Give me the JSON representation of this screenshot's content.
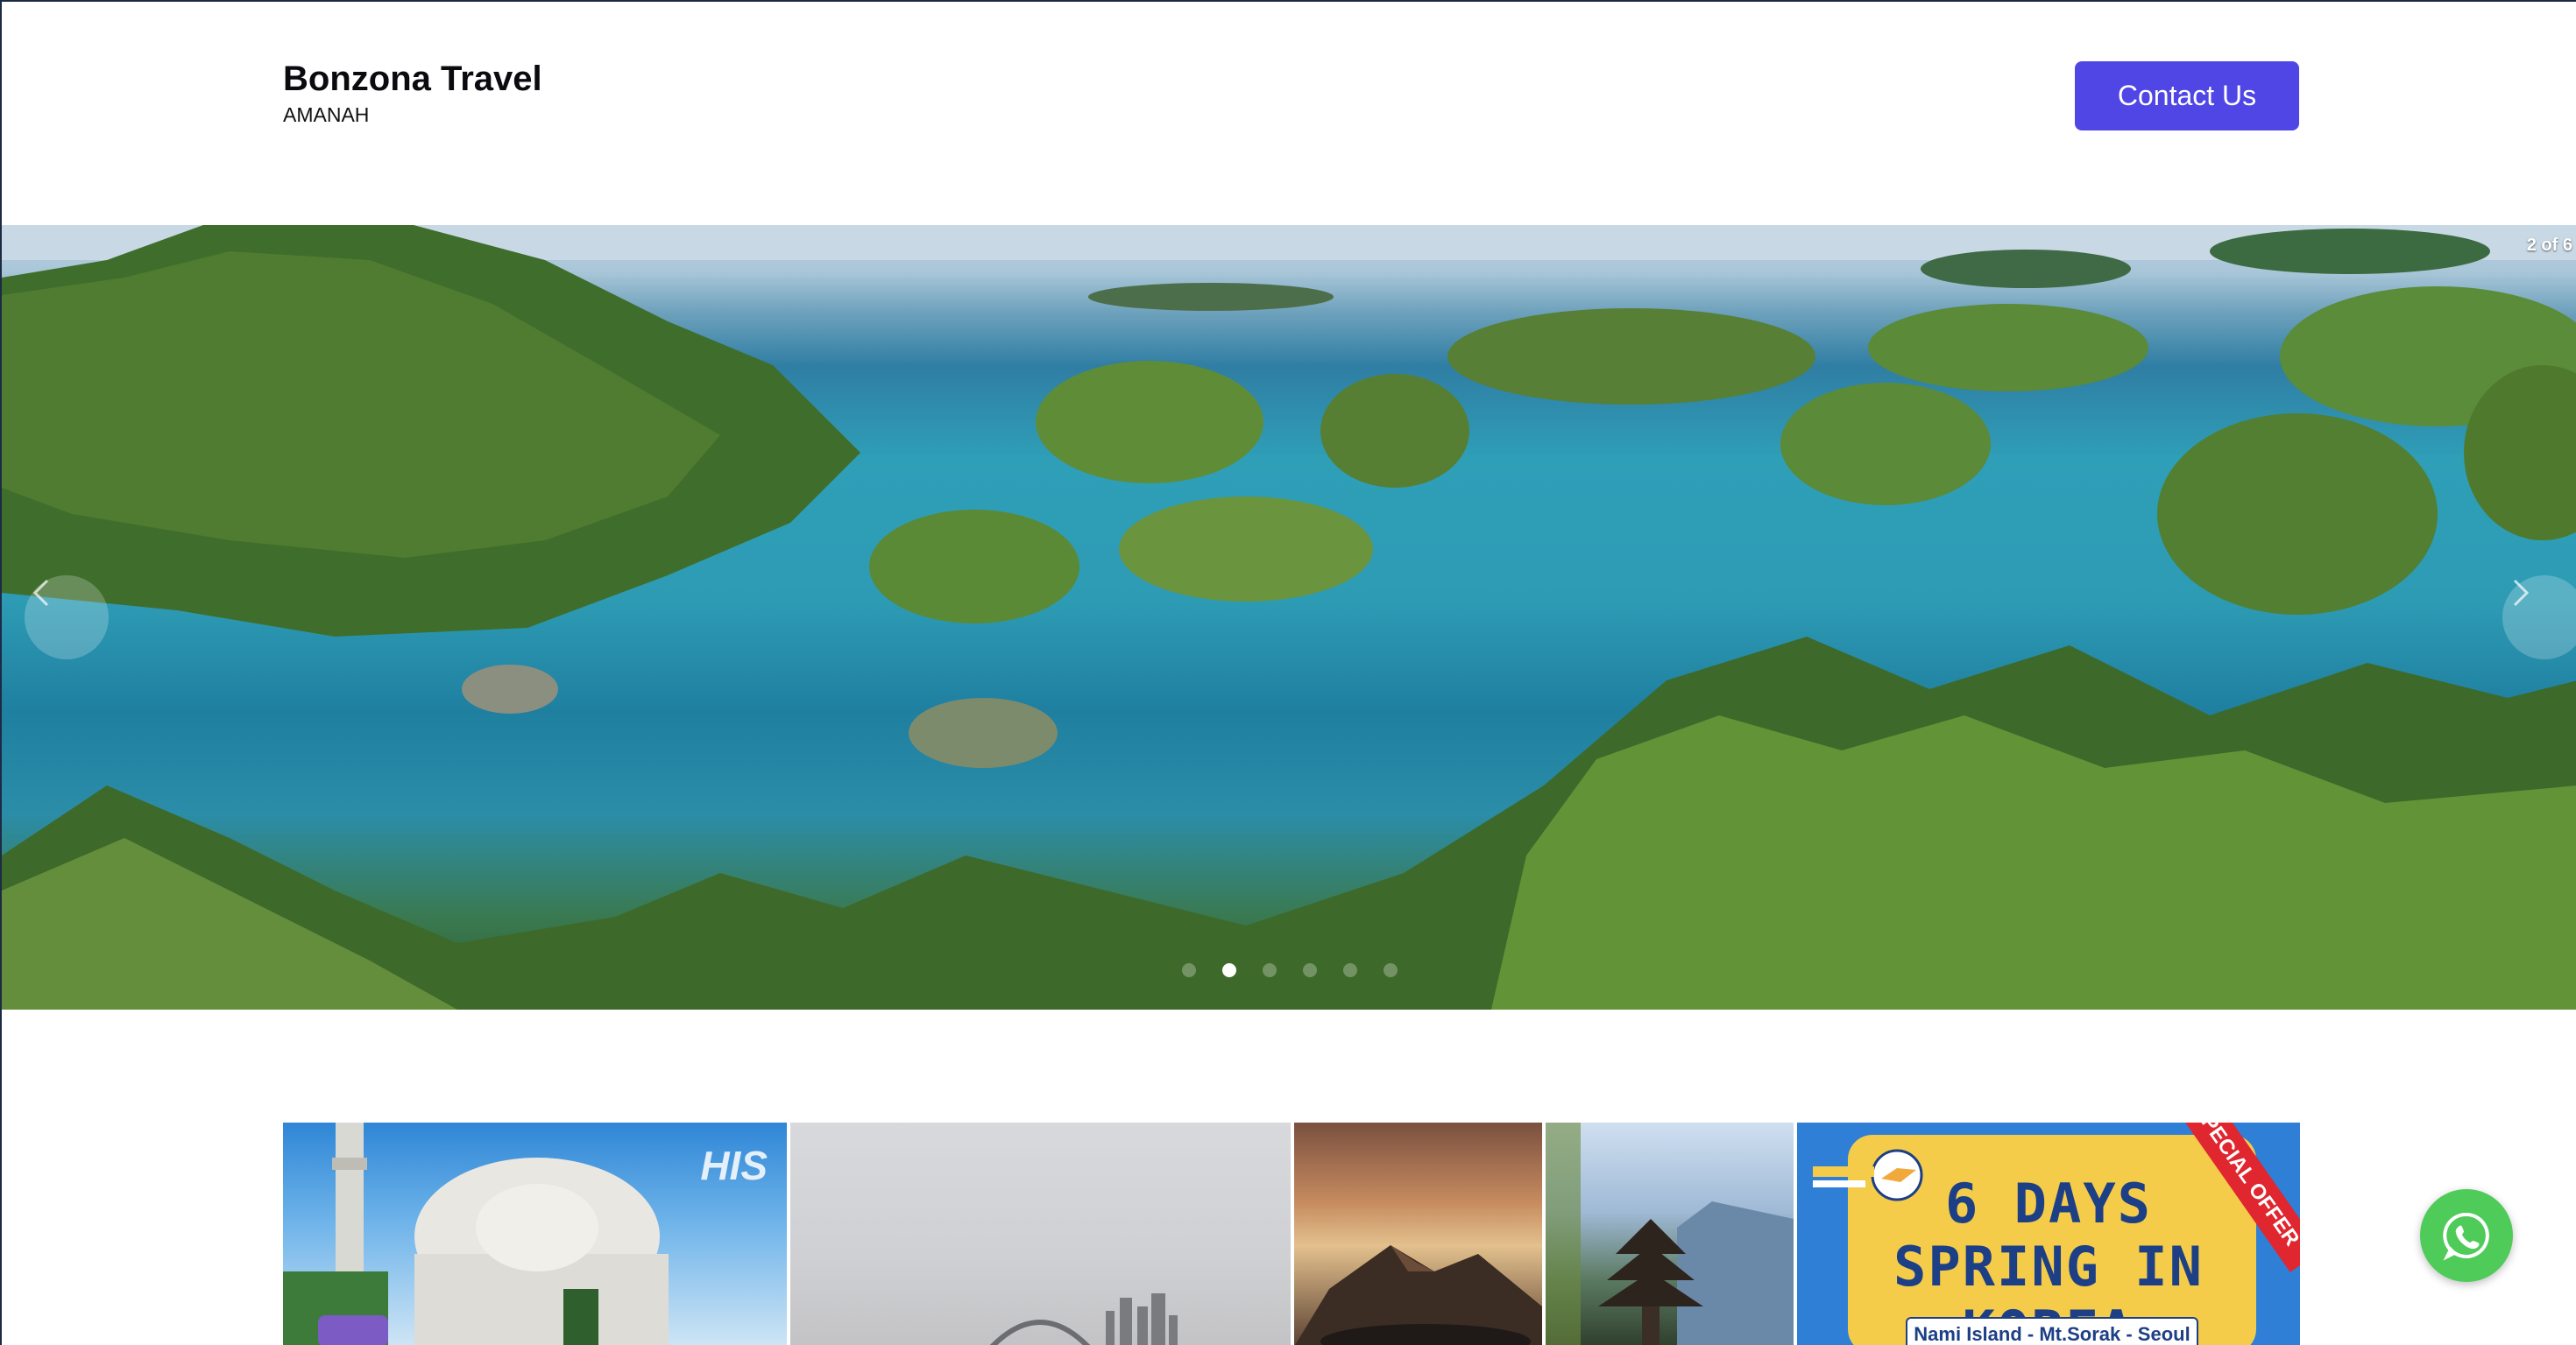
{
  "header": {
    "brand_title": "Bonzona Travel",
    "brand_subtitle": "AMANAH",
    "contact_label": "Contact Us"
  },
  "carousel": {
    "counter": "2 of 6",
    "total_slides": 6,
    "active_slide": 2
  },
  "cards": {
    "card1_brand": "HIS",
    "card5_headline1": "6 DAYS",
    "card5_headline2": "SPRING IN KOREA",
    "card5_places": "Nami Island - Mt.Sorak - Seoul",
    "card5_badge": "SPECIAL OFFER"
  },
  "colors": {
    "accent": "#4f46e5",
    "whatsapp": "#4fcb5a"
  },
  "icons": {
    "prev": "chevron-left-icon",
    "next": "chevron-right-icon",
    "whatsapp": "whatsapp-icon"
  }
}
